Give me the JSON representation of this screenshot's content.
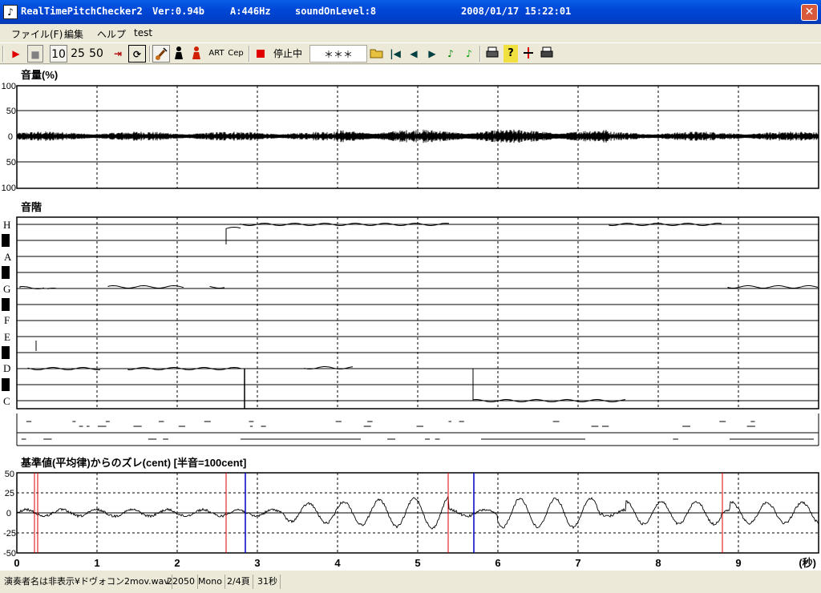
{
  "window": {
    "app_name": "RealTimePitchChecker2",
    "version": "Ver:0.94b",
    "a_freq": "A:446Hz",
    "sound_level": "soundOnLevel:8",
    "datetime": "2008/01/17 15:22:01",
    "close_glyph": "✕"
  },
  "menu": [
    "ファイル(F)",
    "編集",
    "ヘルプ",
    "test"
  ],
  "toolbar": {
    "play": "▶",
    "stop": "■",
    "n10": "10",
    "n25": "25",
    "n50": "50",
    "skip": "⇥",
    "loop": "⟳",
    "art": "ART",
    "cep": "Cep",
    "status": "停止中",
    "stars": "＊＊＊",
    "first": "|◀",
    "prev": "◀",
    "next": "▶",
    "note1": "♪",
    "note2": "♪",
    "help": "?"
  },
  "volume_panel": {
    "title": "音量(%)",
    "ticks": [
      "100",
      "50",
      "0",
      "50",
      "100"
    ]
  },
  "scale_panel": {
    "title": "音階",
    "notes": [
      "H",
      "A",
      "G",
      "F",
      "E",
      "D",
      "C"
    ]
  },
  "cent_panel": {
    "title": "基準値(平均律)からのズレ(cent) [半音=100cent]",
    "ticks": [
      "50",
      "25",
      "0",
      "-25",
      "-50"
    ]
  },
  "time_axis": {
    "labels": [
      "0",
      "1",
      "2",
      "3",
      "4",
      "5",
      "6",
      "7",
      "8",
      "9"
    ],
    "unit": "(秒)"
  },
  "status": {
    "file": "演奏者名は非表示¥ドヴォコン2mov.wav",
    "rate": "22050",
    "channels": "Mono",
    "page": "2/4頁",
    "seconds": "31秒"
  },
  "colors": {
    "red_marker": "#e00000",
    "blue_marker": "#0000c0",
    "trace": "#000000",
    "grid": "#000000"
  }
}
